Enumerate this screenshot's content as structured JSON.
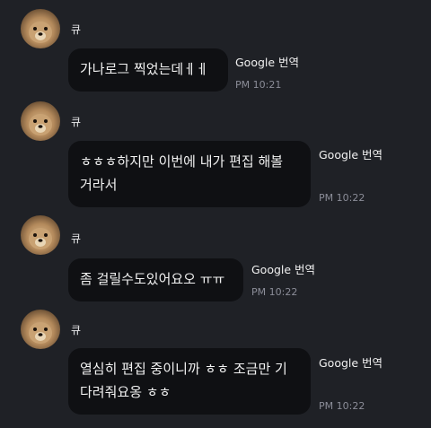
{
  "messages": [
    {
      "sender": "큐",
      "text": "가나로그 찍었는데ㅔㅔ",
      "translate_label": "Google 번역",
      "time": "PM 10:21"
    },
    {
      "sender": "큐",
      "text": "ㅎㅎㅎ하지만 이번에 내가 편집 해볼\n거라서",
      "translate_label": "Google 번역",
      "time": "PM 10:22"
    },
    {
      "sender": "큐",
      "text": "좀 걸릴수도있어요오 ㅠㅠ",
      "translate_label": "Google 번역",
      "time": "PM 10:22"
    },
    {
      "sender": "큐",
      "text": "열심히 편집 중이니까 ㅎㅎ 조금만 기\n다려줘요옹 ㅎㅎ",
      "translate_label": "Google 번역",
      "time": "PM 10:22"
    }
  ],
  "colors": {
    "background": "#1f2126",
    "bubble": "#0f1013",
    "time": "#8b8d98"
  }
}
